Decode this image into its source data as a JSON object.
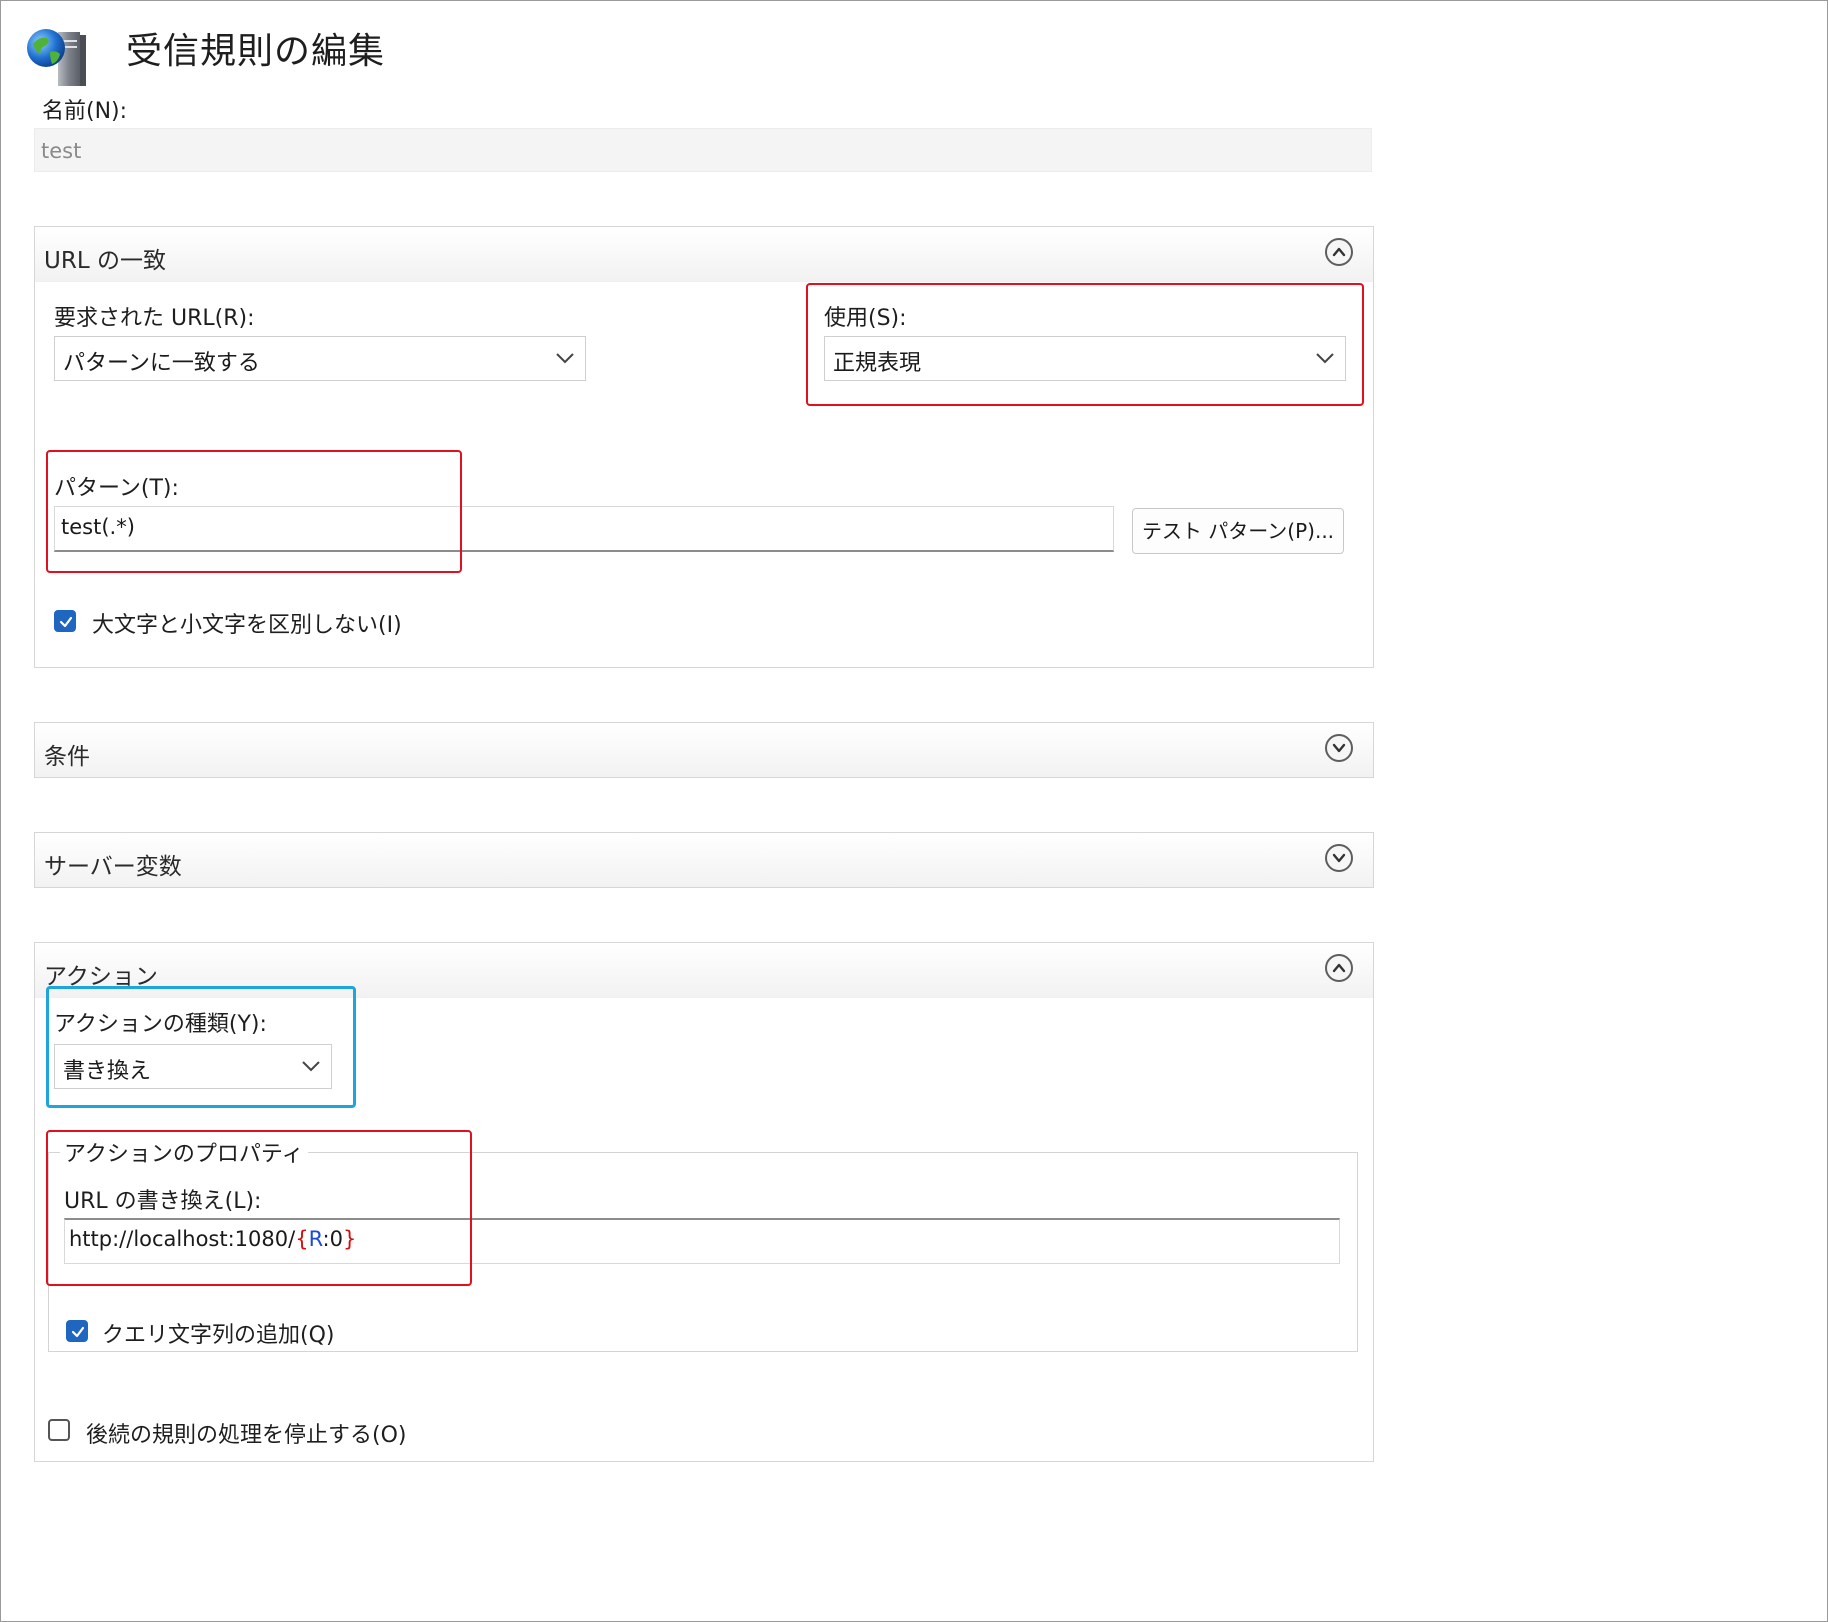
{
  "dialog": {
    "title": "受信規則の編集"
  },
  "name_field": {
    "label": "名前(N):",
    "value": "test"
  },
  "url_match": {
    "title": "URL の一致",
    "requested_url": {
      "label": "要求された URL(R):",
      "value": "パターンに一致する"
    },
    "using": {
      "label": "使用(S):",
      "value": "正規表現"
    },
    "pattern": {
      "label": "パターン(T):",
      "value": "test(.*)"
    },
    "test_pattern_button": "テスト パターン(P)...",
    "ignore_case": {
      "label": "大文字と小文字を区別しない(I)",
      "checked": true
    }
  },
  "conditions": {
    "title": "条件"
  },
  "server_variables": {
    "title": "サーバー変数"
  },
  "action": {
    "title": "アクション",
    "action_type": {
      "label": "アクションの種類(Y):",
      "value": "書き換え"
    },
    "properties": {
      "legend": "アクションのプロパティ",
      "rewrite_url": {
        "label": "URL の書き換え(L):",
        "value_prefix": "http://localhost:1080/",
        "open_brace": "{",
        "var_name": "R",
        "var_suffix": ":0",
        "close_brace": "}"
      },
      "append_query": {
        "label": "クエリ文字列の追加(Q)",
        "checked": true
      }
    },
    "stop_processing": {
      "label": "後続の規則の処理を停止する(O)",
      "checked": false
    }
  },
  "colors": {
    "highlight_red": "#e0101f",
    "highlight_blue": "#1fa5de",
    "checkbox_blue": "#1f66c1"
  },
  "icons": {
    "dialog": "globe-server-icon",
    "expand": "chevron-down-circle-icon",
    "collapse": "chevron-up-circle-icon",
    "dropdown": "chevron-down-icon",
    "check": "checkmark-icon"
  }
}
